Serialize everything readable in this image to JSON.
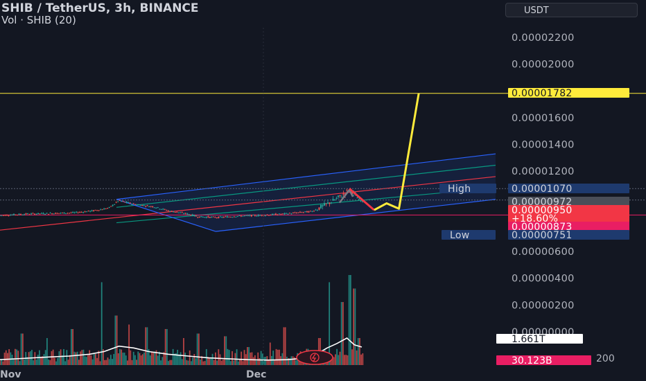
{
  "header": {
    "title": "SHIB / TetherUS, 3h, BINANCE",
    "subtitle": "Vol · SHIB (20)",
    "currency": "USDT"
  },
  "colors": {
    "background": "#131722",
    "axis_text": "#b2b5be",
    "up": "#26a69a",
    "down": "#ef5350",
    "channel_outer": "#2962ff",
    "channel_mid": "#089981",
    "channel_center": "#f23645",
    "target_line": "#ffeb3b"
  },
  "chart_data": {
    "type": "line",
    "title": "SHIB / TetherUS, 3h, BINANCE",
    "ylim": [
      0.0,
      2.4e-05
    ],
    "y_ticks": [
      "0.00002200",
      "0.00002000",
      "0.00001600",
      "0.00001400",
      "0.00001200",
      "0.00000600",
      "0.00000400",
      "0.00000200",
      "0.00000000"
    ],
    "x_ticks": [
      "Nov",
      "Dec"
    ],
    "grid": false,
    "price_labels": [
      {
        "name": "target",
        "text": "0.00001782",
        "value": 1.782e-05,
        "bg": "#ffeb3b",
        "fg": "#131722"
      },
      {
        "name": "high-label",
        "text": "High",
        "value": 1.07e-05,
        "bg": "#1e3a6e",
        "fg": "#d1d4dc",
        "side": "left"
      },
      {
        "name": "high",
        "text": "0.00001070",
        "value": 1.07e-05,
        "bg": "#1e3a6e",
        "fg": "#d1d4dc"
      },
      {
        "name": "prev",
        "text": "0.00000972",
        "value": 9.85e-06,
        "bg": "#4a4e58",
        "fg": "#d1d4dc"
      },
      {
        "name": "last",
        "text": "0.00000950",
        "value": 9.5e-06,
        "bg": "#f23645",
        "fg": "#ffffff"
      },
      {
        "name": "change",
        "text": "+18.60%",
        "value": 9.12e-06,
        "bg": "#f23645",
        "fg": "#ffffff"
      },
      {
        "name": "base",
        "text": "0.00000873",
        "value": 8.73e-06,
        "bg": "#e91e63",
        "fg": "#ffffff"
      },
      {
        "name": "low-label",
        "text": "Low",
        "value": 7.51e-06,
        "bg": "#1e3a6e",
        "fg": "#d1d4dc",
        "side": "left"
      },
      {
        "name": "low",
        "text": "0.00000751",
        "value": 7.51e-06,
        "bg": "#1e3a6e",
        "fg": "#d1d4dc"
      }
    ],
    "volume_labels": [
      {
        "name": "vol-ma",
        "text": "1.661T",
        "bg": "#ffffff",
        "fg": "#131722"
      },
      {
        "name": "vol-last",
        "text": "30.123B",
        "bg": "#e91e63",
        "fg": "#ffffff"
      }
    ],
    "price_path": [
      [
        0.0,
        8.7e-06
      ],
      [
        0.05,
        8.8e-06
      ],
      [
        0.1,
        8.85e-06
      ],
      [
        0.15,
        8.9e-06
      ],
      [
        0.19,
        9.05e-06
      ],
      [
        0.22,
        9.25e-06
      ],
      [
        0.24,
        9.8e-06
      ],
      [
        0.27,
        9.55e-06
      ],
      [
        0.31,
        9.35e-06
      ],
      [
        0.34,
        9.05e-06
      ],
      [
        0.38,
        8.8e-06
      ],
      [
        0.4,
        8.6e-06
      ],
      [
        0.44,
        8.55e-06
      ],
      [
        0.48,
        8.65e-06
      ],
      [
        0.52,
        8.7e-06
      ],
      [
        0.57,
        8.8e-06
      ],
      [
        0.6,
        8.9e-06
      ],
      [
        0.63,
        9e-06
      ],
      [
        0.655,
        9.45e-06
      ],
      [
        0.675,
        9.85e-06
      ],
      [
        0.695,
        1.03e-05
      ],
      [
        0.705,
        1.065e-05
      ],
      [
        0.715,
        1.03e-05
      ],
      [
        0.725,
        9.85e-06
      ],
      [
        0.735,
        9.7e-06
      ]
    ],
    "forecast_path": [
      {
        "color": "#f23645",
        "points": [
          [
            0.705,
            1.07e-05
          ],
          [
            0.755,
            9.1e-06
          ]
        ]
      },
      {
        "color": "#ffeb3b",
        "points": [
          [
            0.755,
            9.1e-06
          ],
          [
            0.78,
            9.6e-06
          ],
          [
            0.805,
            9.2e-06
          ],
          [
            0.845,
            1.782e-05
          ]
        ]
      }
    ],
    "channel": {
      "upper": [
        [
          0.235,
          9.9e-06
        ],
        [
          1.0,
          1.33e-05
        ]
      ],
      "lower": [
        [
          0.435,
          7.5e-06
        ],
        [
          1.0,
          9.9e-06
        ]
      ],
      "lines": [
        {
          "color": "#2962ff",
          "a": [
            0.235,
            9.9e-06
          ],
          "b": [
            1.0,
            1.33e-05
          ]
        },
        {
          "color": "#089981",
          "a": [
            0.235,
            9.3e-06
          ],
          "b": [
            1.0,
            1.245e-05
          ]
        },
        {
          "color": "#f23645",
          "a": [
            0.0,
            7.6e-06
          ],
          "b": [
            1.0,
            1.16e-05
          ]
        },
        {
          "color": "#089981",
          "a": [
            0.235,
            8.15e-06
          ],
          "b": [
            1.0,
            1.075e-05
          ]
        },
        {
          "color": "#2962ff",
          "a": [
            0.435,
            7.5e-06
          ],
          "b": [
            1.0,
            9.9e-06
          ]
        }
      ],
      "diagonal": [
        [
          0.235,
          9.9e-06
        ],
        [
          0.435,
          7.5e-06
        ]
      ]
    },
    "horizontal_levels": [
      {
        "value": 1.782e-05,
        "color": "#ffeb3b"
      },
      {
        "value": 1.07e-05,
        "color": "#5d6474"
      },
      {
        "value": 9.85e-06,
        "color": "#5d6474"
      },
      {
        "value": 8.73e-06,
        "color": "#e91e63"
      }
    ],
    "volume_ma": [
      [
        0.0,
        0.12
      ],
      [
        0.05,
        0.15
      ],
      [
        0.1,
        0.18
      ],
      [
        0.14,
        0.2
      ],
      [
        0.18,
        0.24
      ],
      [
        0.21,
        0.3
      ],
      [
        0.24,
        0.42
      ],
      [
        0.27,
        0.38
      ],
      [
        0.3,
        0.3
      ],
      [
        0.34,
        0.24
      ],
      [
        0.38,
        0.2
      ],
      [
        0.42,
        0.16
      ],
      [
        0.46,
        0.14
      ],
      [
        0.5,
        0.12
      ],
      [
        0.54,
        0.11
      ],
      [
        0.58,
        0.12
      ],
      [
        0.61,
        0.15
      ],
      [
        0.64,
        0.25
      ],
      [
        0.66,
        0.38
      ],
      [
        0.68,
        0.48
      ],
      [
        0.7,
        0.6
      ],
      [
        0.715,
        0.45
      ],
      [
        0.73,
        0.4
      ]
    ],
    "volume_spikes": [
      [
        0.045,
        0.35
      ],
      [
        0.095,
        0.3
      ],
      [
        0.145,
        0.4
      ],
      [
        0.205,
        0.92
      ],
      [
        0.235,
        0.55
      ],
      [
        0.26,
        0.45
      ],
      [
        0.295,
        0.42
      ],
      [
        0.335,
        0.4
      ],
      [
        0.37,
        0.3
      ],
      [
        0.4,
        0.35
      ],
      [
        0.455,
        0.32
      ],
      [
        0.5,
        0.2
      ],
      [
        0.545,
        0.25
      ],
      [
        0.575,
        0.42
      ],
      [
        0.62,
        0.18
      ],
      [
        0.645,
        0.3
      ],
      [
        0.665,
        0.92
      ],
      [
        0.69,
        0.7
      ],
      [
        0.705,
        1.0
      ],
      [
        0.715,
        0.85
      ],
      [
        0.725,
        0.3
      ]
    ]
  }
}
